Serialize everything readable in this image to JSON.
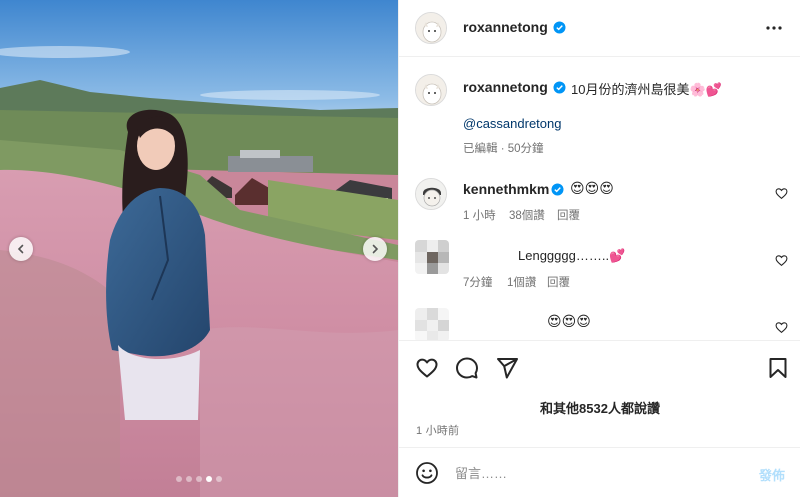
{
  "media": {
    "dots": [
      false,
      false,
      false,
      true,
      false
    ],
    "prev_icon": "chevron-left-icon",
    "next_icon": "chevron-right-icon"
  },
  "header": {
    "username": "roxannetong",
    "verified": true,
    "more_icon": "more-horizontal-icon"
  },
  "caption": {
    "username": "roxannetong",
    "text": "10月份的濟州島很美🌸💕",
    "mention": "@cassandretong",
    "meta": "已編輯 · 50分鐘"
  },
  "comments": [
    {
      "username": "kennethmkm",
      "verified": true,
      "text": "😍😍😍",
      "time": "1 小時",
      "likes": "38個讚",
      "reply": "回覆"
    },
    {
      "username": "",
      "text": "Lenggggg……..💕",
      "time": "7分鐘",
      "likes": "1個讚",
      "reply": "回覆"
    },
    {
      "username": "",
      "text": "😍😍😍"
    }
  ],
  "actions": {
    "likes_text": "和其他8532人都說讚",
    "time_ago": "1 小時前"
  },
  "composer": {
    "placeholder": "留言……",
    "post_label": "發佈"
  },
  "colors": {
    "verified_blue": "#0095f6",
    "post_disabled": "#b2dffc",
    "meta_gray": "#737373"
  }
}
